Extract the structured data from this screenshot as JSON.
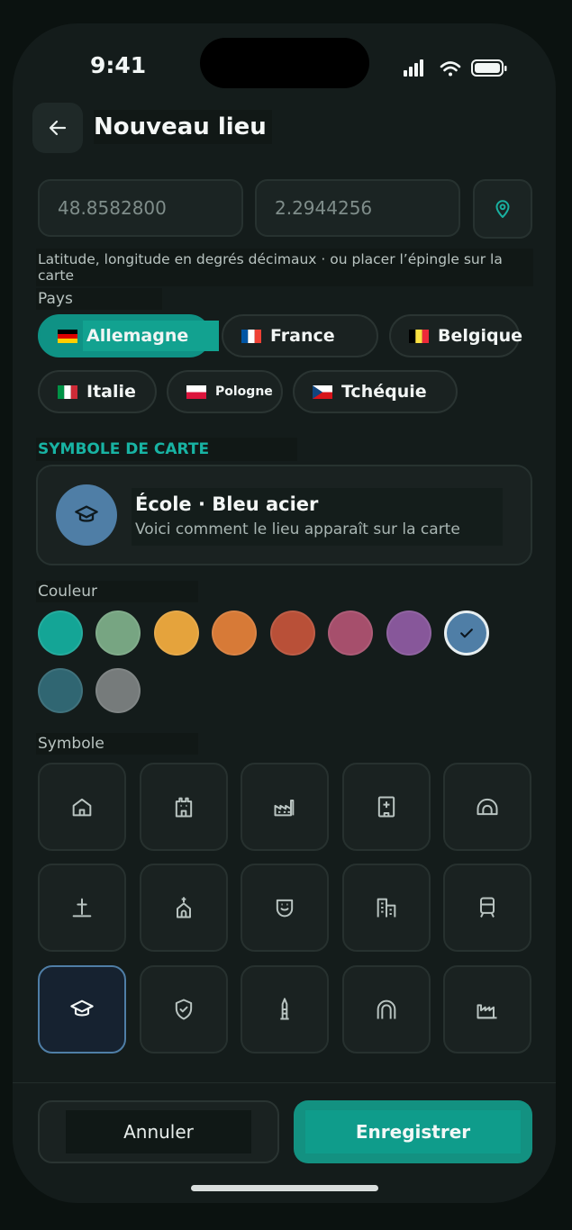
{
  "status_bar": {
    "time": "9:41"
  },
  "header": {
    "title": "Nouveau lieu"
  },
  "coords": {
    "latitude": "48.8582800",
    "longitude": "2.2944256",
    "hint": "Latitude, longitude en degrés décimaux · ou placer l’épingle sur la carte"
  },
  "country": {
    "label": "Pays",
    "chips": [
      {
        "name": "Allemagne",
        "flag": "de",
        "selected": true
      },
      {
        "name": "France",
        "flag": "fr",
        "selected": false
      },
      {
        "name": "Belgique",
        "flag": "be",
        "selected": false
      },
      {
        "name": "Italie",
        "flag": "it",
        "selected": false
      },
      {
        "name": "Pologne",
        "flag": "pl",
        "selected": false
      },
      {
        "name": "Tchéquie",
        "flag": "cz",
        "selected": false
      }
    ]
  },
  "map_symbol": {
    "section_title": "SYMBOLE DE CARTE",
    "preview_name": "École · Bleu acier",
    "preview_subtitle": "Voici comment le lieu apparaît sur la carte",
    "preview_icon": "graduation-cap-icon"
  },
  "color": {
    "label": "Couleur",
    "swatches": [
      {
        "hex": "#14a596",
        "selected": false
      },
      {
        "hex": "#77a582",
        "selected": false
      },
      {
        "hex": "#e5a33c",
        "selected": false
      },
      {
        "hex": "#d77a37",
        "selected": false
      },
      {
        "hex": "#b95038",
        "selected": false
      },
      {
        "hex": "#a64f6c",
        "selected": false
      },
      {
        "hex": "#87579a",
        "selected": false
      },
      {
        "hex": "#4f7ea6",
        "selected": true
      },
      {
        "hex": "#306672",
        "selected": false
      },
      {
        "hex": "#767b7b",
        "selected": false
      }
    ]
  },
  "symbol": {
    "label": "Symbole",
    "icons": [
      {
        "name": "house-icon",
        "selected": false
      },
      {
        "name": "castle-icon",
        "selected": false
      },
      {
        "name": "factory-icon",
        "selected": false
      },
      {
        "name": "hospital-icon",
        "selected": false
      },
      {
        "name": "tunnel-icon",
        "selected": false
      },
      {
        "name": "grave-cross-icon",
        "selected": false
      },
      {
        "name": "church-icon",
        "selected": false
      },
      {
        "name": "theater-mask-icon",
        "selected": false
      },
      {
        "name": "buildings-icon",
        "selected": false
      },
      {
        "name": "tram-icon",
        "selected": false
      },
      {
        "name": "graduation-cap-icon",
        "selected": true
      },
      {
        "name": "shield-check-icon",
        "selected": false
      },
      {
        "name": "tower-icon",
        "selected": false
      },
      {
        "name": "arch-icon",
        "selected": false
      },
      {
        "name": "industry-icon",
        "selected": false
      }
    ]
  },
  "actions": {
    "cancel": "Annuler",
    "save": "Enregistrer"
  },
  "colors": {
    "accent": "#0f9285",
    "background": "#141c1b",
    "selected": "#4f7ea6"
  }
}
